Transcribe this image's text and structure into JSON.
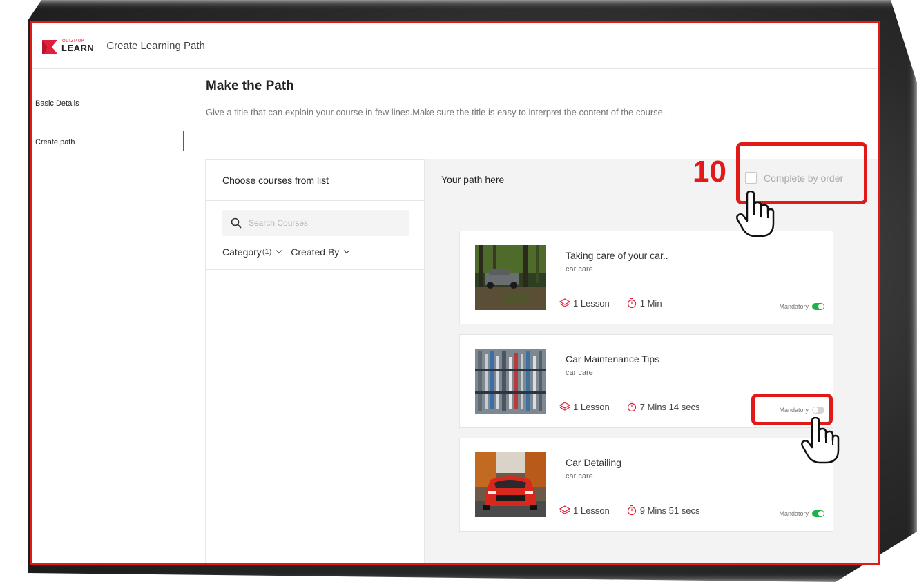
{
  "app": {
    "logo_small": "OUIZMOR",
    "logo_text": "LEARN",
    "title": "Create Learning Path"
  },
  "sidebar": {
    "items": [
      {
        "label": "Basic Details",
        "active": false
      },
      {
        "label": "Create path",
        "active": true
      }
    ]
  },
  "page": {
    "title": "Make the Path",
    "subtitle": "Give a title that can explain your course in few lines.Make sure the title is easy to interpret the content of the course."
  },
  "courses_panel": {
    "header": "Choose courses from list",
    "search_placeholder": "Search Courses",
    "filters": [
      {
        "label": "Category",
        "count": "(1)"
      },
      {
        "label": "Created By",
        "count": ""
      }
    ]
  },
  "path_panel": {
    "header": "Your path here",
    "complete_by_order_label": "Complete by order",
    "complete_by_order_checked": false
  },
  "courses": [
    {
      "title": "Taking care of your car..",
      "category": "car care",
      "lessons": "1 Lesson",
      "duration": "1 Min",
      "mandatory_label": "Mandatory",
      "mandatory": true,
      "thumb": "forest-jeep"
    },
    {
      "title": "Car Maintenance Tips",
      "category": "car care",
      "lessons": "1 Lesson",
      "duration": "7 Mins 14 secs",
      "mandatory_label": "Mandatory",
      "mandatory": false,
      "thumb": "tools-wall"
    },
    {
      "title": "Car Detailing",
      "category": "car care",
      "lessons": "1 Lesson",
      "duration": "9 Mins 51 secs",
      "mandatory_label": "Mandatory",
      "mandatory": true,
      "thumb": "red-car"
    }
  ],
  "annotation": {
    "step_number": "10"
  },
  "colors": {
    "accent": "#e0203a",
    "callout": "#e11919",
    "toggle_on": "#1fb246",
    "toggle_off": "#d3d3d3"
  }
}
